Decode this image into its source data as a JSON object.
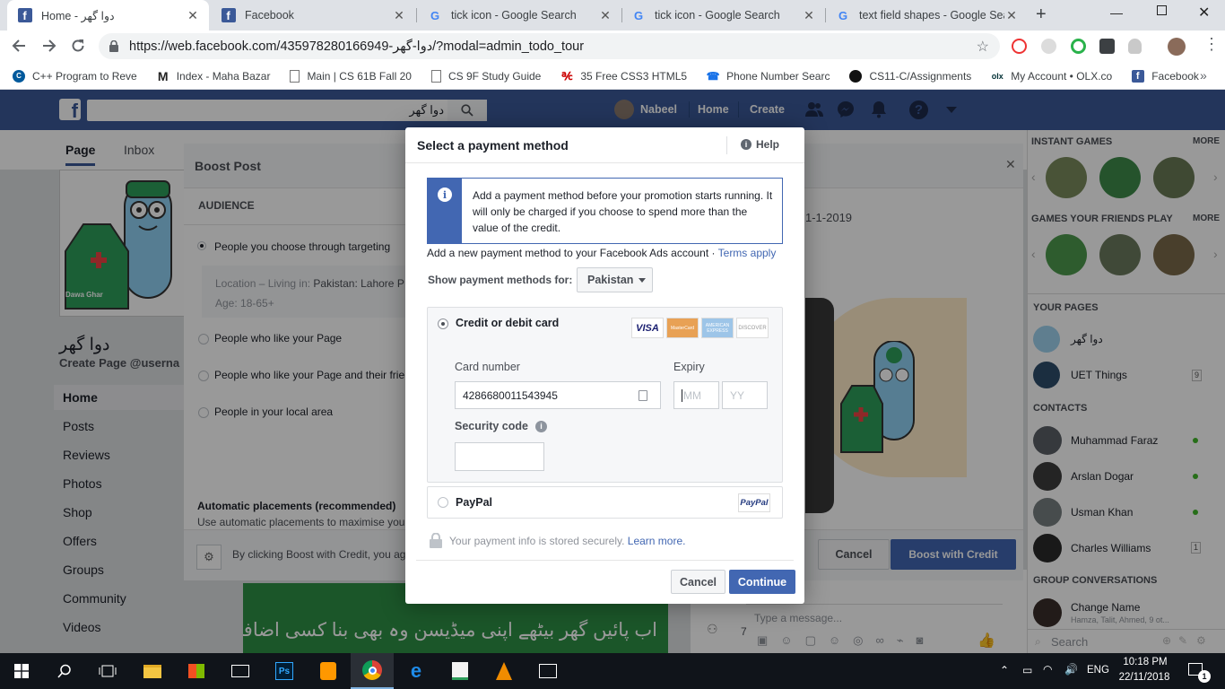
{
  "browser": {
    "tabs": [
      {
        "title": "Home - دوا گھر",
        "icon": "facebook-icon"
      },
      {
        "title": "Facebook",
        "icon": "facebook-icon"
      },
      {
        "title": "tick icon - Google Search",
        "icon": "google-icon"
      },
      {
        "title": "tick icon - Google Search",
        "icon": "google-icon"
      },
      {
        "title": "text field shapes - Google Sear",
        "icon": "google-icon"
      }
    ],
    "url": "https://web.facebook.com/435978280166949-دوا-گھر/?modal=admin_todo_tour",
    "bookmarks": [
      "C++ Program to Reve",
      "Index - Maha Bazar",
      "Main | CS 61B Fall 20",
      "CS 9F Study Guide",
      "35 Free CSS3 HTML5",
      "Phone Number Searc",
      "CS11-C/Assignments",
      "My Account • OLX.co",
      "Facebook"
    ]
  },
  "fb_header": {
    "search_value": "دوا گھر",
    "user_name": "Nabeel",
    "home_label": "Home",
    "create_label": "Create"
  },
  "page": {
    "tabs": [
      "Page",
      "Inbox"
    ],
    "name": "دوا گھر",
    "username_prompt": "Create Page @userna",
    "logo_text": "Dawa Ghar",
    "nav": [
      "Home",
      "Posts",
      "Reviews",
      "Photos",
      "Shop",
      "Offers",
      "Groups",
      "Community",
      "Videos"
    ],
    "urdu_banner": "اب پائیں گھر بیٹھے اپنی میڈیسن وہ بھی بنا کسی اضافی چارجز کے"
  },
  "boost_post": {
    "title": "Boost Post",
    "audience_label": "AUDIENCE",
    "options": [
      "People you choose through targeting",
      "People who like your Page",
      "People who like your Page and their frie",
      "People in your local area"
    ],
    "location_label": "Location – Living in:",
    "location_value": "Pakistan: Lahore P",
    "age_text": "Age: 18-65+",
    "date_text": "1-1-2019",
    "placements_title": "Automatic placements (recommended)",
    "placements_desc": "Use automatic placements to maximise your",
    "footer_text": "By clicking Boost with Credit, you ag",
    "cancel_label": "Cancel",
    "boost_label": "Boost with Credit"
  },
  "modal": {
    "title": "Select a payment method",
    "help_label": "Help",
    "notice": "Add a payment method before your promotion starts running. It will only be charged if you choose to spend more than the value of the credit.",
    "add_method_text": "Add a new payment method to your Facebook Ads account · ",
    "terms_link": "Terms apply",
    "show_methods_label": "Show payment methods for:",
    "country": "Pakistan",
    "credit_option_label": "Credit or debit card",
    "card_logos": [
      "VISA",
      "MasterCard",
      "AMERICAN EXPRESS",
      "DISCOVER"
    ],
    "card_number_label": "Card number",
    "card_number_value": "4286680011543945",
    "expiry_label": "Expiry",
    "expiry_month_placeholder": "MM",
    "expiry_year_placeholder": "YY",
    "security_code_label": "Security code",
    "paypal_label": "PayPal",
    "paypal_logo": "PayPal",
    "secure_text": "Your payment info is stored securely.",
    "learn_more": "Learn more.",
    "cancel_label": "Cancel",
    "continue_label": "Continue"
  },
  "right_sidebar": {
    "instant_games": "INSTANT GAMES",
    "games_friends": "GAMES YOUR FRIENDS PLAY",
    "more": "MORE",
    "your_pages": "YOUR PAGES",
    "pages": [
      {
        "name": "دوا گھر",
        "badge": ""
      },
      {
        "name": "UET Things",
        "badge": "9"
      }
    ],
    "contacts_label": "CONTACTS",
    "contacts": [
      {
        "name": "Muhammad Faraz",
        "status": "online"
      },
      {
        "name": "Arslan Dogar",
        "status": "online"
      },
      {
        "name": "Usman Khan",
        "status": "online"
      },
      {
        "name": "Charles Williams",
        "status": "1"
      }
    ],
    "group_conv_label": "GROUP CONVERSATIONS",
    "group_name": "Change Name",
    "group_members": "Hamza, Talit, Ahmed, 9 ot...",
    "search_placeholder": "Search"
  },
  "chat": {
    "placeholder": "Type a message...",
    "count": "7"
  },
  "taskbar": {
    "time": "10:18 PM",
    "date": "22/11/2018",
    "lang": "ENG",
    "notifications": "1"
  }
}
